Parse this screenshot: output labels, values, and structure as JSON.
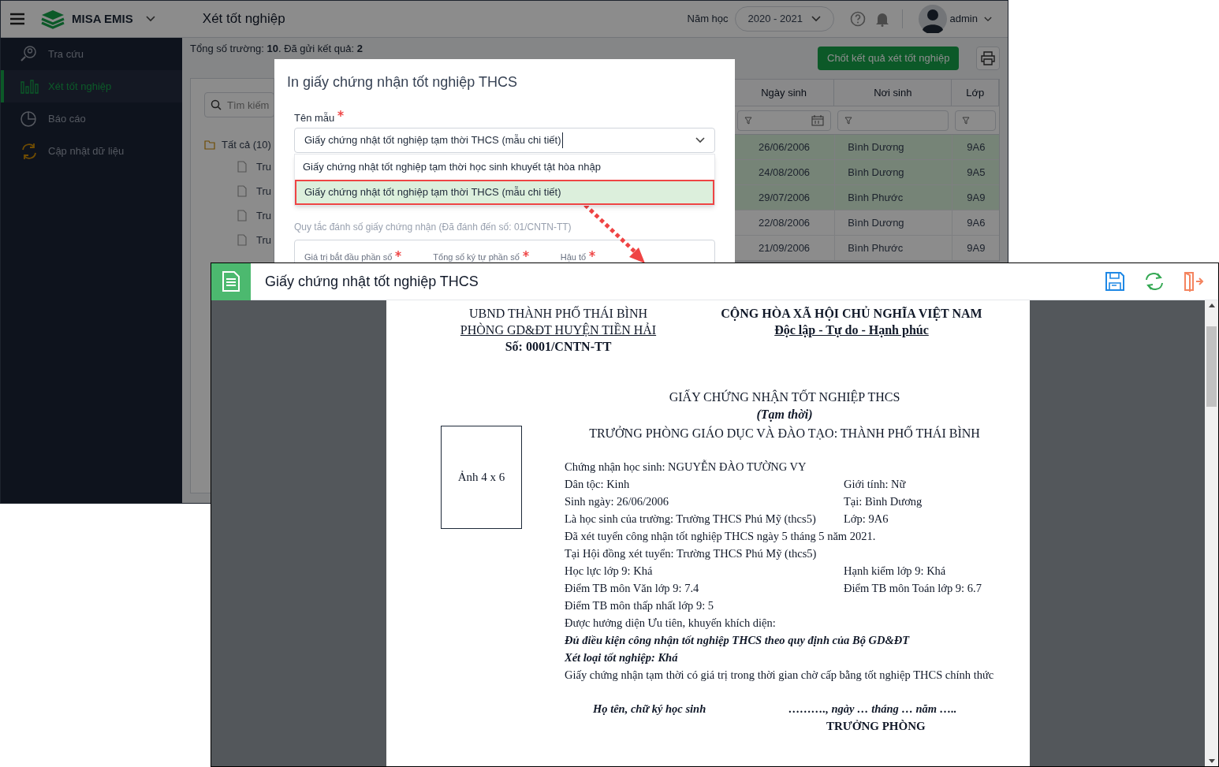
{
  "app": {
    "brand": "MISA EMIS",
    "page_title": "Xét tốt nghiệp",
    "year_label": "Năm học",
    "year": "2020 - 2021",
    "user": "admin"
  },
  "sidebar": {
    "items": [
      {
        "label": "Tra cứu",
        "kind": "search",
        "selected": false
      },
      {
        "label": "Xét tốt nghiệp",
        "kind": "chart",
        "selected": true
      },
      {
        "label": "Báo cáo",
        "kind": "pie",
        "selected": false
      },
      {
        "label": "Cập nhật dữ liệu",
        "kind": "sync",
        "selected": false
      }
    ]
  },
  "summary": "Tổng số trường: **10**. Đã gửi kết quả: **2**",
  "confirm_button": "Chốt kết quả xét tốt nghiệp",
  "search": {
    "placeholder": "Tìm kiếm"
  },
  "tree": {
    "label": "Tất cả (10)",
    "children": [
      {
        "label": "Tru"
      },
      {
        "label": "Tru"
      },
      {
        "label": "Tru"
      },
      {
        "label": "Tru"
      }
    ]
  },
  "table": {
    "columns": [
      "Ngày sinh",
      "Nơi sinh",
      "Lớp"
    ],
    "rows": [
      {
        "cells": [
          "26/06/2006",
          "Bình Dương",
          "9A6"
        ],
        "selected": true
      },
      {
        "cells": [
          "24/08/2006",
          "Bình Dương",
          "9A5"
        ],
        "selected": true
      },
      {
        "cells": [
          "29/07/2006",
          "Bình Phước",
          "9A9"
        ],
        "selected": true
      },
      {
        "cells": [
          "22/08/2006",
          "Bình Dương",
          "9A6"
        ],
        "selected": false
      },
      {
        "cells": [
          "21/09/2006",
          "Bình Phước",
          "9A9"
        ],
        "selected": false
      }
    ]
  },
  "dialog": {
    "title": "In giấy chứng nhận tốt nghiệp THCS",
    "template_label": "Tên mẫu",
    "template_required": true,
    "template_value": "Giấy chứng nhật tốt nghiệp tạm thời THCS (mẫu chi tiết)",
    "options": [
      {
        "label": "Giấy chứng nhật tốt nghiệp tạm thời học sinh khuyết tật hòa nhập",
        "selected": false
      },
      {
        "label": "Giấy chứng nhật tốt nghiệp tạm thời THCS (mẫu chi tiết)",
        "selected": true
      }
    ],
    "numbering_label": "Quy tắc đánh số giấy chứng nhận (Đã đánh đến số: 01/CNTN-TT)",
    "numbering_fields": [
      {
        "label": "Giá trị bắt đầu phần số",
        "required": true
      },
      {
        "label": "Tổng số ký tự phần số",
        "required": true
      },
      {
        "label": "Hậu tố",
        "required": true
      }
    ]
  },
  "preview": {
    "title": "Giấy chứng nhật tốt nghiệp THCS",
    "header_left": [
      "UBND THÀNH PHỐ THÁI BÌNH",
      "PHÒNG GD&ĐT HUYỆN TIỀN HẢI",
      "Số: 0001/CNTN-TT"
    ],
    "header_right": [
      "CỘNG HÒA XÃ HỘI CHỦ NGHĨA VIỆT NAM",
      "Độc lập - Tự do - Hạnh phúc"
    ],
    "doc_title": "GIẤY CHỨNG NHẬN TỐT NGHIỆP THCS",
    "doc_subtitle": "(Tạm thời)",
    "issuer": "TRƯỞNG PHÒNG GIÁO DỤC VÀ ĐÀO TẠO: THÀNH PHỐ THÁI BÌNH",
    "photo": "Ảnh 4 x 6",
    "lines": [
      {
        "left": "Chứng nhận học sinh: NGUYỄN ĐÀO TƯỜNG VY",
        "kind": "plain"
      },
      {
        "left": "Dân tộc: Kinh",
        "right": "Giới tính: Nữ",
        "kind": "plain"
      },
      {
        "left": "Sinh ngày: 26/06/2006",
        "right": "Tại: Bình Dương",
        "kind": "plain"
      },
      {
        "left": "Là học sinh của trường: Trường THCS Phú Mỹ (thcs5)",
        "right": "Lớp: 9A6",
        "kind": "plain"
      },
      {
        "left": "Đã xét tuyển công nhận tốt nghiệp THCS ngày 5 tháng 5 năm 2021.",
        "kind": "plain"
      },
      {
        "left": "Tại Hội đồng xét tuyển: Trường THCS Phú Mỹ (thcs5)",
        "kind": "plain"
      },
      {
        "left": "Học lực lớp 9: Khá",
        "right": "Hạnh kiểm lớp 9: Khá",
        "kind": "plain"
      },
      {
        "left": "Điểm TB môn Văn lớp 9: 7.4",
        "right": "Điểm TB môn Toán lớp 9: 6.7",
        "kind": "plain"
      },
      {
        "left": "Điểm TB môn thấp nhất lớp 9: 5",
        "kind": "plain"
      },
      {
        "left": "Được hưởng diện Ưu tiên, khuyến khích diện:",
        "kind": "plain"
      },
      {
        "left": "Đủ điều kiện công nhận tốt nghiệp THCS theo quy định của Bộ GD&ĐT",
        "kind": "emphasis"
      },
      {
        "left": "Xét loại tốt nghiệp: Khá",
        "kind": "emphasis"
      },
      {
        "left": "Giấy chứng nhận tạm thời có giá trị trong thời gian chờ cấp bằng tốt nghiệp THCS chính thức",
        "kind": "plain"
      }
    ],
    "sign_left": "Họ tên, chữ ký học sinh",
    "sign_right": "………., ngày … tháng … năm …..",
    "sign_role": "TRƯỞNG PHÒNG"
  }
}
